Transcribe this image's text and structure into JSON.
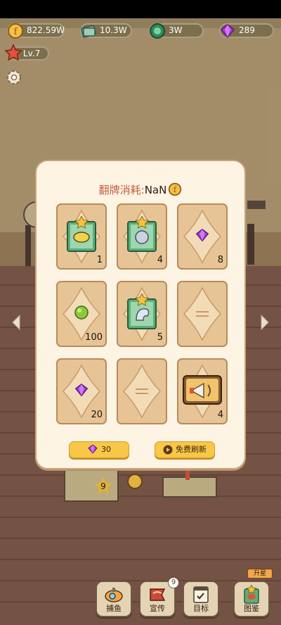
{
  "resources": [
    {
      "icon": "coin-icon",
      "value": "822.59W"
    },
    {
      "icon": "bills-icon",
      "value": "10.3W"
    },
    {
      "icon": "green-coin-icon",
      "value": "3W"
    },
    {
      "icon": "gem-icon",
      "value": "289"
    }
  ],
  "level": {
    "label": "Lv.7"
  },
  "modal": {
    "cost_label": "翻牌消耗:",
    "cost_value": "NaN",
    "cards": [
      {
        "item": "fish-card-icon",
        "count": "1"
      },
      {
        "item": "pufferfish-card-icon",
        "count": "4"
      },
      {
        "item": "gem-icon",
        "count": "8"
      },
      {
        "item": "green-ball-icon",
        "count": "100"
      },
      {
        "item": "shrimp-card-icon",
        "count": "5"
      },
      {
        "item": "face-down",
        "count": ""
      },
      {
        "item": "gem-icon",
        "count": "20"
      },
      {
        "item": "face-down",
        "count": ""
      },
      {
        "item": "megaphone-icon",
        "count": "4"
      }
    ],
    "gem_button": "30",
    "refresh_button": "免费刷新"
  },
  "background": {
    "tank_count": "9"
  },
  "nav": {
    "fishing": "捕鱼",
    "promote": "宣传",
    "promote_badge": "9",
    "goals": "目标",
    "album": "图鉴",
    "upgrade_tag": "升星"
  }
}
